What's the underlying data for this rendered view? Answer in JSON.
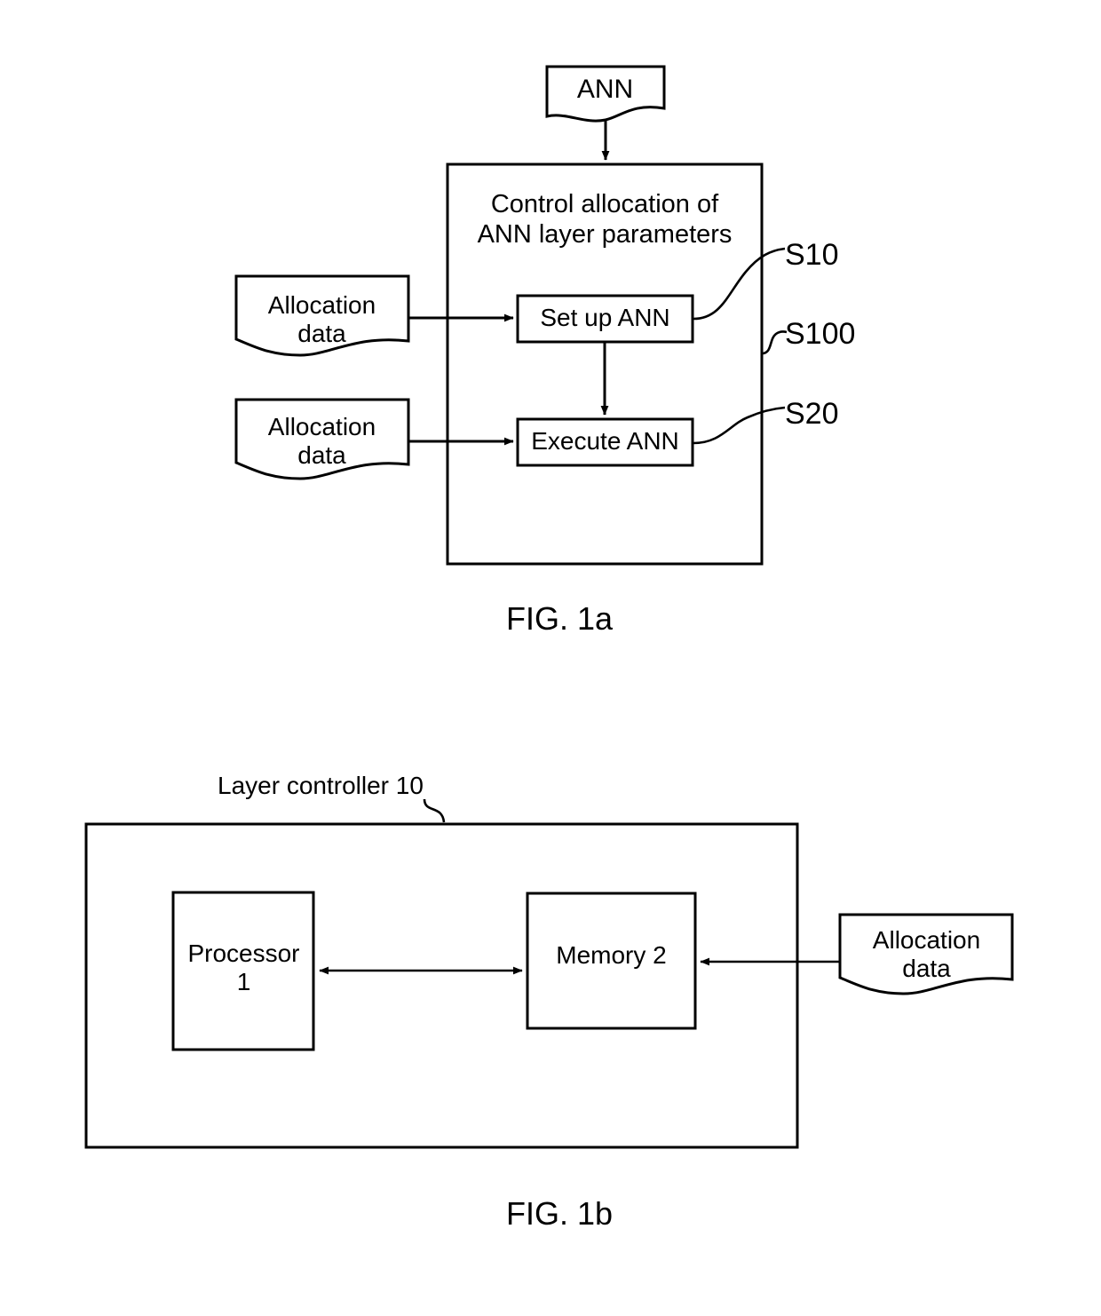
{
  "document": {
    "type": "patent-figure-sheet",
    "figures": [
      {
        "id": "fig-1a",
        "caption": "FIG. 1a",
        "nodes": {
          "ann_input": "ANN",
          "control_block_title": "Control allocation of\nANN layer parameters",
          "step_setup": "Set up ANN",
          "step_execute": "Execute ANN",
          "allocation_data_top": "Allocation\ndata",
          "allocation_data_bottom": "Allocation\ndata"
        },
        "reference_labels": {
          "setup_step": "S10",
          "outer_process": "S100",
          "execute_step": "S20"
        }
      },
      {
        "id": "fig-1b",
        "caption": "FIG. 1b",
        "nodes": {
          "outer_label": "Layer controller 10",
          "processor": "Processor\n1",
          "memory": "Memory 2",
          "allocation_data": "Allocation\ndata"
        }
      }
    ]
  },
  "style": {
    "ink": "#000000",
    "paper": "#ffffff"
  }
}
